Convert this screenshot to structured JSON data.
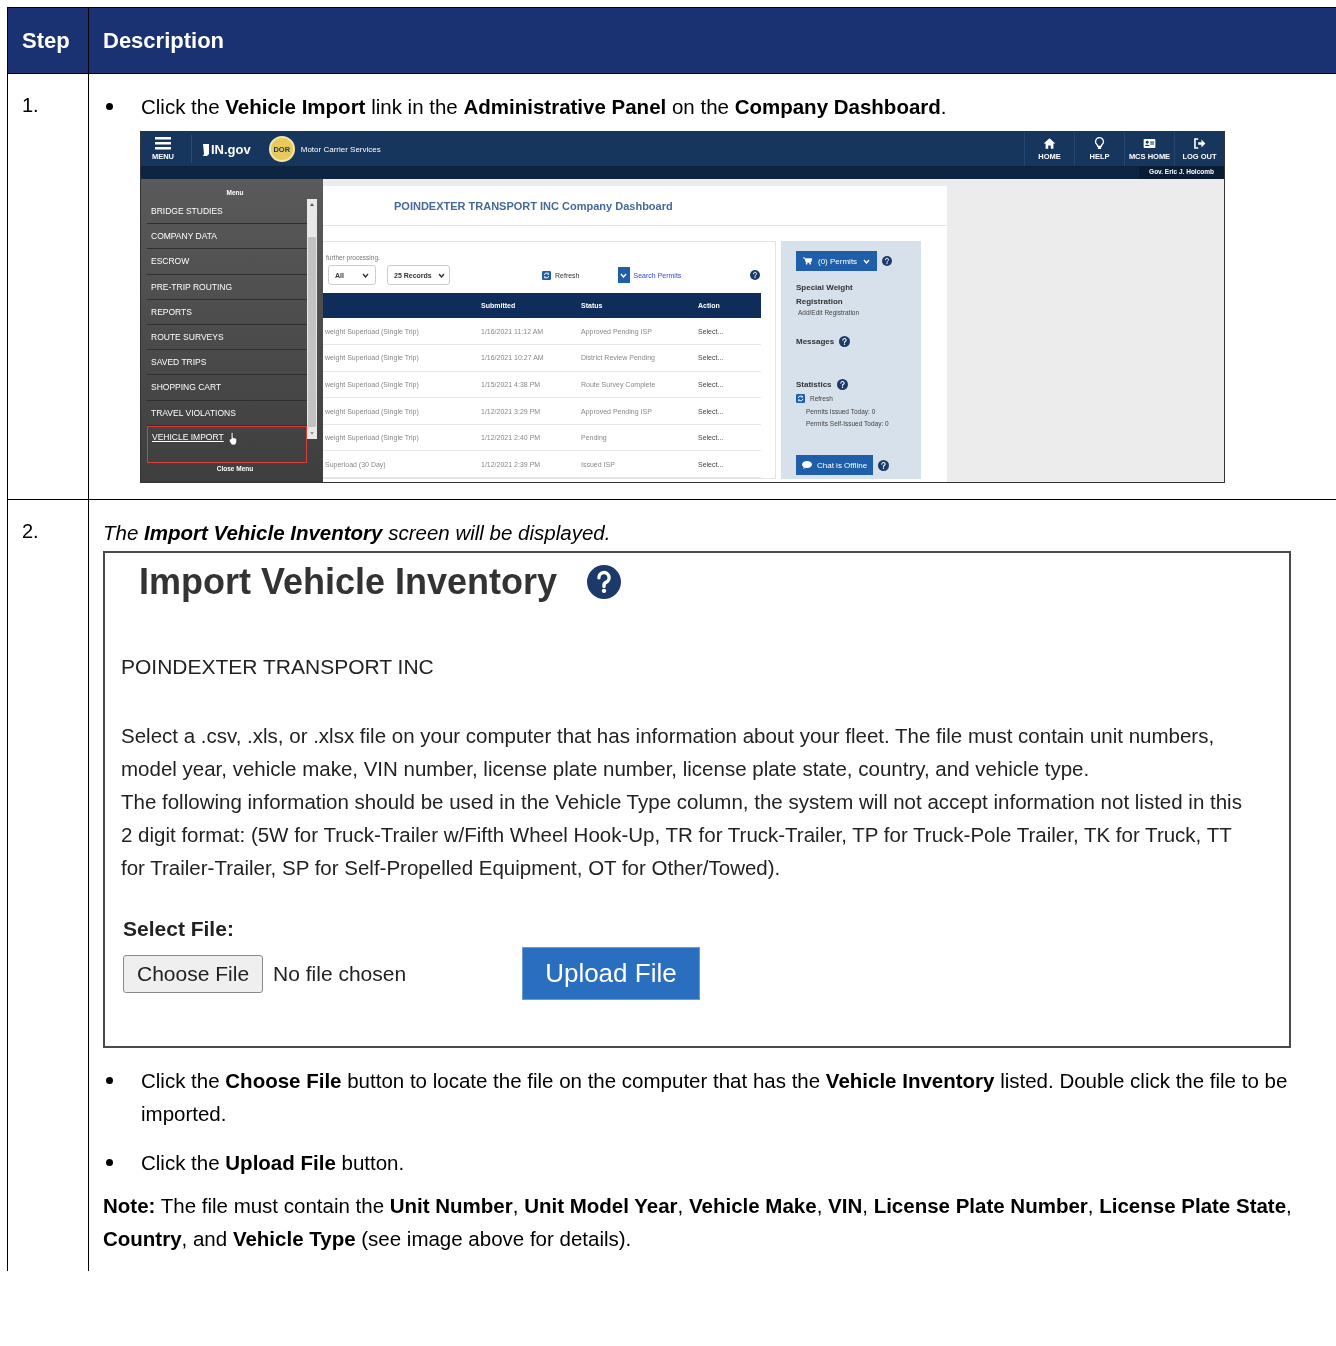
{
  "table": {
    "columns": [
      "Step",
      "Description"
    ],
    "rows": [
      {
        "step": "1.",
        "content": [
          {
            "kind": "bullet",
            "text": "Click the **Vehicle Import** link in the **Administrative Panel** on the **Company Dashboard**."
          },
          {
            "kind": "dashboard",
            "header": {
              "menu_label": "MENU",
              "logo": "IN.gov",
              "seal": "DOR",
              "title": "Motor Carrier Services",
              "user": "Gov. Eric J. Holcomb",
              "nav": [
                {
                  "label": "HOME"
                },
                {
                  "label": "HELP"
                },
                {
                  "label": "MCS HOME"
                },
                {
                  "label": "LOG OUT"
                }
              ]
            },
            "menu": {
              "title": "Menu",
              "close": "Close Menu",
              "items": [
                {
                  "label": "BRIDGE STUDIES",
                  "selected": false
                },
                {
                  "label": "COMPANY DATA",
                  "selected": false
                },
                {
                  "label": "ESCROW",
                  "selected": false
                },
                {
                  "label": "PRE-TRIP ROUTING",
                  "selected": false
                },
                {
                  "label": "REPORTS",
                  "selected": false
                },
                {
                  "label": "ROUTE SURVEYS",
                  "selected": false
                },
                {
                  "label": "SAVED TRIPS",
                  "selected": false
                },
                {
                  "label": "SHOPPING CART",
                  "selected": false
                },
                {
                  "label": "TRAVEL VIOLATIONS",
                  "selected": false
                },
                {
                  "label": "VEHICLE IMPORT",
                  "selected": true
                }
              ]
            },
            "main": {
              "title": "POINDEXTER TRANSPORT INC Company Dashboard",
              "note": "further processing.",
              "filter": "All",
              "records": "25 Records",
              "refresh": "Refresh",
              "search": "Search Permits",
              "columns": [
                "Submitted",
                "Status",
                "Action"
              ],
              "rows": [
                {
                  "type": "weight Superload (Single Trip)",
                  "submitted": "1/16/2021 11:12 AM",
                  "status": "Approved Pending ISP",
                  "action": "Select..."
                },
                {
                  "type": "weight Superload (Single Trip)",
                  "submitted": "1/16/2021 10:27 AM",
                  "status": "District Review Pending",
                  "action": "Select..."
                },
                {
                  "type": "weight Superload (Single Trip)",
                  "submitted": "1/15/2021 4:38 PM",
                  "status": "Route Survey Complete",
                  "action": "Select..."
                },
                {
                  "type": "weight Superload (Single Trip)",
                  "submitted": "1/12/2021 3:29 PM",
                  "status": "Approved Pending ISP",
                  "action": "Select..."
                },
                {
                  "type": "weight Superload (Single Trip)",
                  "submitted": "1/12/2021 2:40 PM",
                  "status": "Pending",
                  "action": "Select..."
                },
                {
                  "type": "Superload (30 Day)",
                  "submitted": "1/12/2021 2:39 PM",
                  "status": "Issued ISP",
                  "action": "Select..."
                }
              ]
            },
            "side": {
              "cart": "(0) Permits",
              "registration_title": "Special Weight Registration",
              "registration_link": "Add/Edit Registration",
              "messages": "Messages",
              "statistics": "Statistics",
              "refresh": "Refresh",
              "stats": [
                "Permits Issued Today: 0",
                "Permits Self-Issued Today: 0"
              ],
              "chat": "Chat is Offline"
            }
          }
        ]
      },
      {
        "step": "2.",
        "content": [
          {
            "kind": "italic",
            "text": "The **Import Vehicle Inventory** screen will be displayed."
          },
          {
            "kind": "import_screen",
            "title": "Import Vehicle Inventory",
            "company": "POINDEXTER TRANSPORT INC",
            "paragraphs": [
              "Select a .csv, .xls, or .xlsx file on your computer that has information about your fleet. The file must contain unit numbers, model year, vehicle make, VIN number, license plate number, license plate state, country, and vehicle type.",
              "The following information should be used in the Vehicle Type column, the system will not accept information not listed in this 2 digit format: (5W for Truck-Trailer w/Fifth Wheel Hook-Up, TR for Truck-Trailer, TP for Truck-Pole Trailer, TK for Truck, TT for Trailer-Trailer, SP for Self-Propelled Equipment, OT for Other/Towed)."
            ],
            "file_label": "Select File:",
            "choose": "Choose File",
            "file_status": "No file chosen",
            "upload": "Upload File"
          },
          {
            "kind": "bullet",
            "text": "Click the **Choose File** button to locate the file on the computer that has the **Vehicle Inventory** listed. Double click the file to be imported."
          },
          {
            "kind": "bullet",
            "text": "Click the **Upload File** button."
          },
          {
            "kind": "note",
            "text": "**Note:** The file must contain the **Unit Number**, **Unit Model Year**, **Vehicle Make**, **VIN**, **License Plate Number**, **License Plate State**, **Country**, and **Vehicle Type** (see image above for details)."
          }
        ]
      }
    ]
  }
}
